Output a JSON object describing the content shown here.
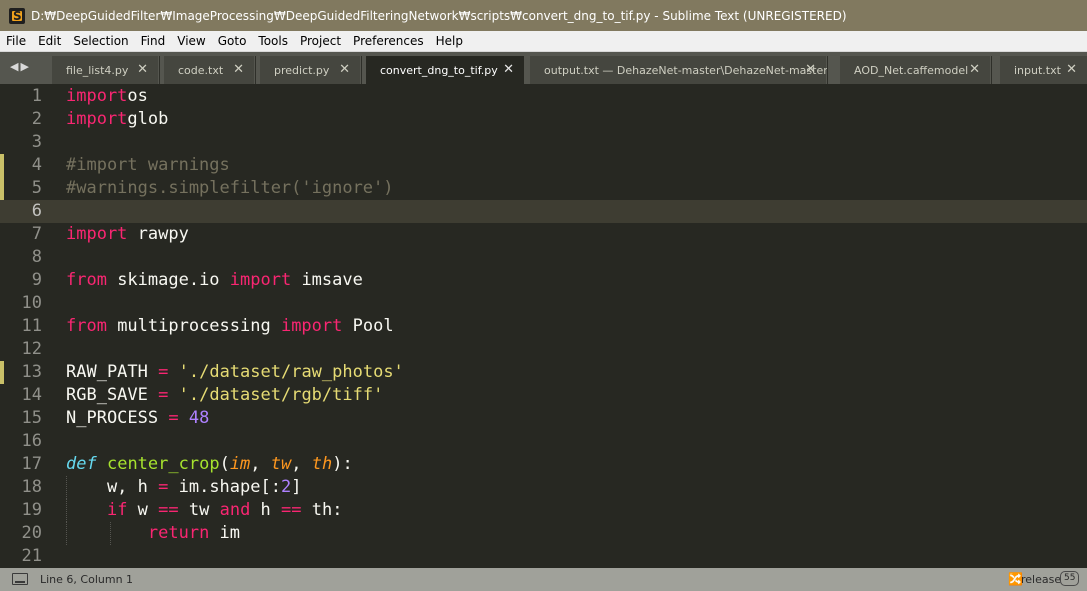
{
  "window": {
    "title": "D:₩DeepGuidedFilter₩ImageProcessing₩DeepGuidedFilteringNetwork₩scripts₩convert_dng_to_tif.py - Sublime Text (UNREGISTERED)",
    "app_icon": "sublime-text-icon"
  },
  "menu": [
    "File",
    "Edit",
    "Selection",
    "Find",
    "View",
    "Goto",
    "Tools",
    "Project",
    "Preferences",
    "Help"
  ],
  "tabs": [
    {
      "label": "file_list4.py",
      "active": false
    },
    {
      "label": "code.txt",
      "active": false
    },
    {
      "label": "predict.py",
      "active": false
    },
    {
      "label": "convert_dng_to_tif.py",
      "active": true
    },
    {
      "label": "output.txt — DehazeNet-master\\DehazeNet-master",
      "active": false
    },
    {
      "label": "AOD_Net.caffemodel",
      "active": false
    },
    {
      "label": "input.txt",
      "active": false
    }
  ],
  "tab_close_glyph": "✕",
  "tab_nav_glyph": "◀▶",
  "editor": {
    "current_line": 6,
    "modified_lines": [
      4,
      5,
      13
    ],
    "lines": [
      {
        "n": "1",
        "tokens": [
          [
            "kw",
            "import"
          ],
          [
            "",
            "os"
          ]
        ]
      },
      {
        "n": "2",
        "tokens": [
          [
            "kw",
            "import"
          ],
          [
            "",
            "glob"
          ]
        ]
      },
      {
        "n": "3",
        "tokens": []
      },
      {
        "n": "4",
        "tokens": [
          [
            "cm",
            "#import warnings"
          ]
        ]
      },
      {
        "n": "5",
        "tokens": [
          [
            "cm",
            "#warnings.simplefilter('ignore')"
          ]
        ]
      },
      {
        "n": "6",
        "tokens": []
      },
      {
        "n": "7",
        "tokens": [
          [
            "kw",
            "import"
          ],
          [
            "",
            " rawpy"
          ]
        ]
      },
      {
        "n": "8",
        "tokens": []
      },
      {
        "n": "9",
        "tokens": [
          [
            "kw",
            "from"
          ],
          [
            "",
            " skimage.io "
          ],
          [
            "kw",
            "import"
          ],
          [
            "",
            " imsave"
          ]
        ]
      },
      {
        "n": "10",
        "tokens": []
      },
      {
        "n": "11",
        "tokens": [
          [
            "kw",
            "from"
          ],
          [
            "",
            " multiprocessing "
          ],
          [
            "kw",
            "import"
          ],
          [
            "",
            " Pool"
          ]
        ]
      },
      {
        "n": "12",
        "tokens": []
      },
      {
        "n": "13",
        "tokens": [
          [
            "",
            "RAW_PATH "
          ],
          [
            "kw",
            "="
          ],
          [
            "",
            " "
          ],
          [
            "st",
            "'./dataset/raw_photos'"
          ]
        ]
      },
      {
        "n": "14",
        "tokens": [
          [
            "",
            "RGB_SAVE "
          ],
          [
            "kw",
            "="
          ],
          [
            "",
            " "
          ],
          [
            "st",
            "'./dataset/rgb/tiff'"
          ]
        ]
      },
      {
        "n": "15",
        "tokens": [
          [
            "",
            "N_PROCESS "
          ],
          [
            "kw",
            "="
          ],
          [
            "",
            " "
          ],
          [
            "nm",
            "48"
          ]
        ]
      },
      {
        "n": "16",
        "tokens": []
      },
      {
        "n": "17",
        "tokens": [
          [
            "sto",
            "def"
          ],
          [
            "",
            " "
          ],
          [
            "fn",
            "center_crop"
          ],
          [
            "",
            "("
          ],
          [
            "pa",
            "im"
          ],
          [
            "",
            ", "
          ],
          [
            "pa",
            "tw"
          ],
          [
            "",
            ", "
          ],
          [
            "pa",
            "th"
          ],
          [
            "",
            "):"
          ]
        ]
      },
      {
        "n": "18",
        "tokens": [
          [
            "",
            "    w, h "
          ],
          [
            "kw",
            "="
          ],
          [
            "",
            " im.shape[:"
          ],
          [
            "nm",
            "2"
          ],
          [
            "",
            "]"
          ]
        ]
      },
      {
        "n": "19",
        "tokens": [
          [
            "",
            "    "
          ],
          [
            "kw",
            "if"
          ],
          [
            "",
            " w "
          ],
          [
            "kw",
            "=="
          ],
          [
            "",
            " tw "
          ],
          [
            "kw",
            "and"
          ],
          [
            "",
            " h "
          ],
          [
            "kw",
            "=="
          ],
          [
            "",
            " th:"
          ]
        ]
      },
      {
        "n": "20",
        "tokens": [
          [
            "",
            "        "
          ],
          [
            "kw",
            "return"
          ],
          [
            "",
            " im"
          ]
        ]
      },
      {
        "n": "21",
        "tokens": []
      }
    ]
  },
  "status": {
    "icon": "panel-toggle-icon",
    "position": "Line 6, Column 1",
    "branch_icon": "git-branch-icon",
    "branch_glyph": "ᨫ",
    "branch": "release",
    "badge": "55"
  },
  "colors": {
    "background": "#272822",
    "keyword": "#f92672",
    "string": "#e6db74",
    "comment": "#75715e",
    "number": "#ae81ff",
    "storage": "#66d9ef",
    "function": "#a6e22e",
    "parameter": "#fd971f",
    "titlebar": "#81795f",
    "statusbar": "#a0a19a"
  }
}
